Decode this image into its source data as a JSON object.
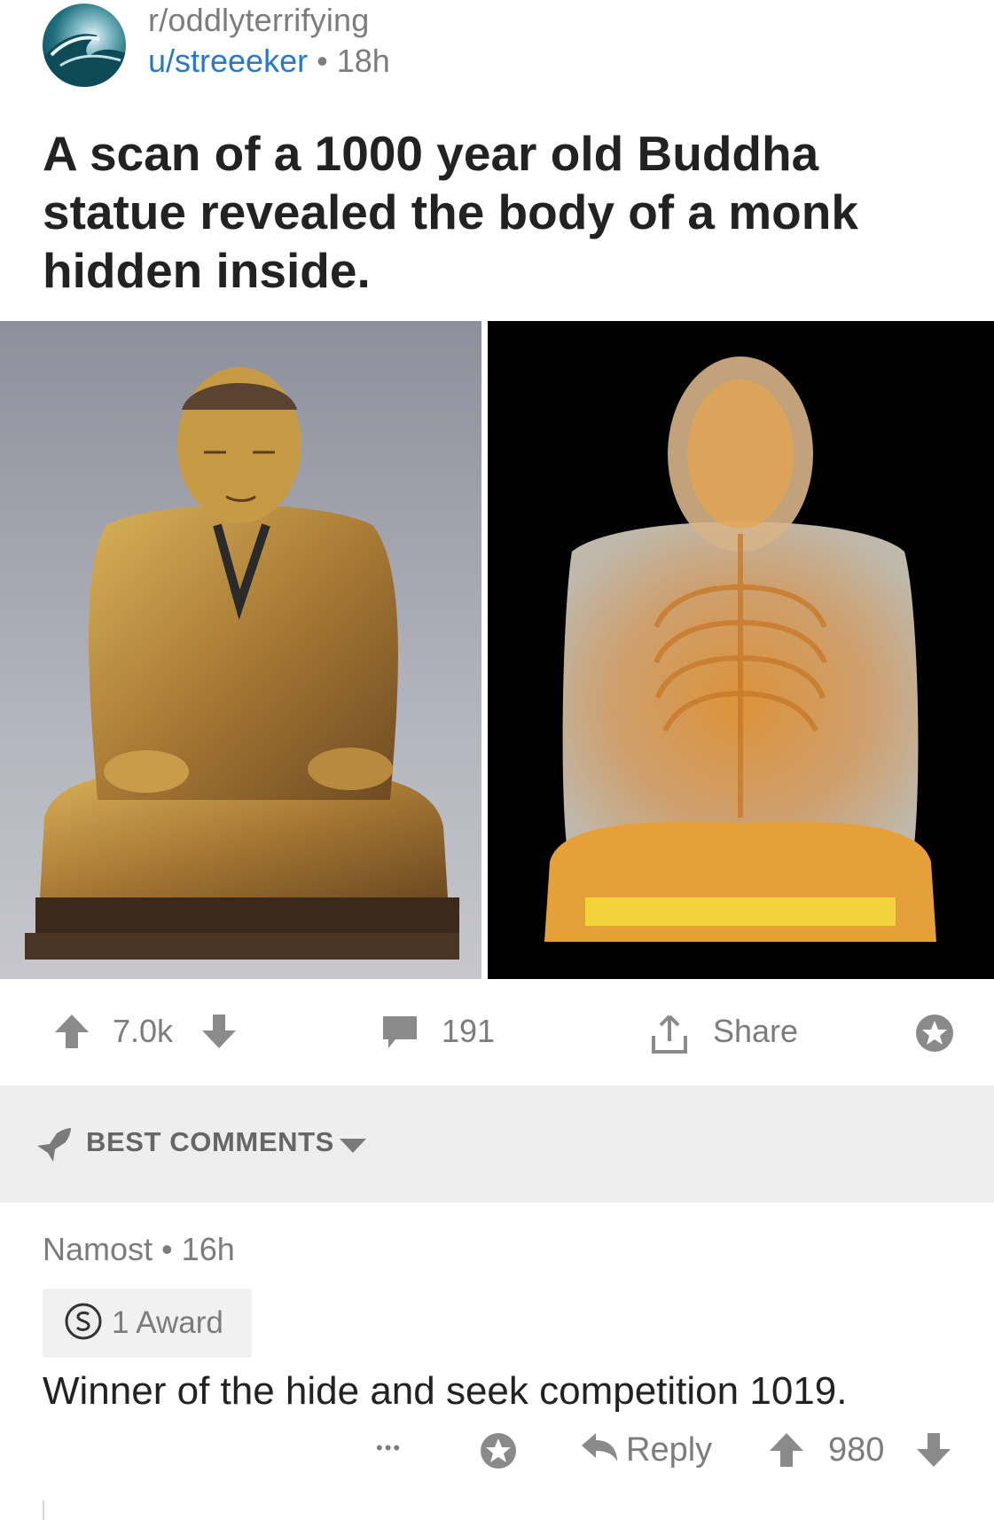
{
  "post": {
    "subreddit": "r/oddlyterrifying",
    "author": "u/streeeker",
    "separator": "•",
    "age": "18h",
    "title": "A scan of a 1000 year old Buddha statue revealed the body of a monk hidden inside."
  },
  "actions": {
    "upvotes": "7.0k",
    "comments": "191",
    "share_label": "Share"
  },
  "comments_section": {
    "sort_label": "BEST COMMENTS"
  },
  "comment": {
    "author": "Namost",
    "separator": "•",
    "age": "16h",
    "award_label": "1 Award",
    "body": "Winner of the hide and seek competition 1019.",
    "more": "•••",
    "reply_label": "Reply",
    "score": "980"
  },
  "icons": {
    "upvote": "arrow-up-icon",
    "downvote": "arrow-down-icon",
    "comment": "speech-bubble-icon",
    "share": "share-icon",
    "save": "star-icon",
    "sort": "rocket-icon",
    "award": "silver-coin-icon",
    "reply": "reply-arrow-icon"
  },
  "colors": {
    "link": "#2a77c9",
    "meta": "#7c7c7c",
    "section_bg": "#eeeeef"
  }
}
